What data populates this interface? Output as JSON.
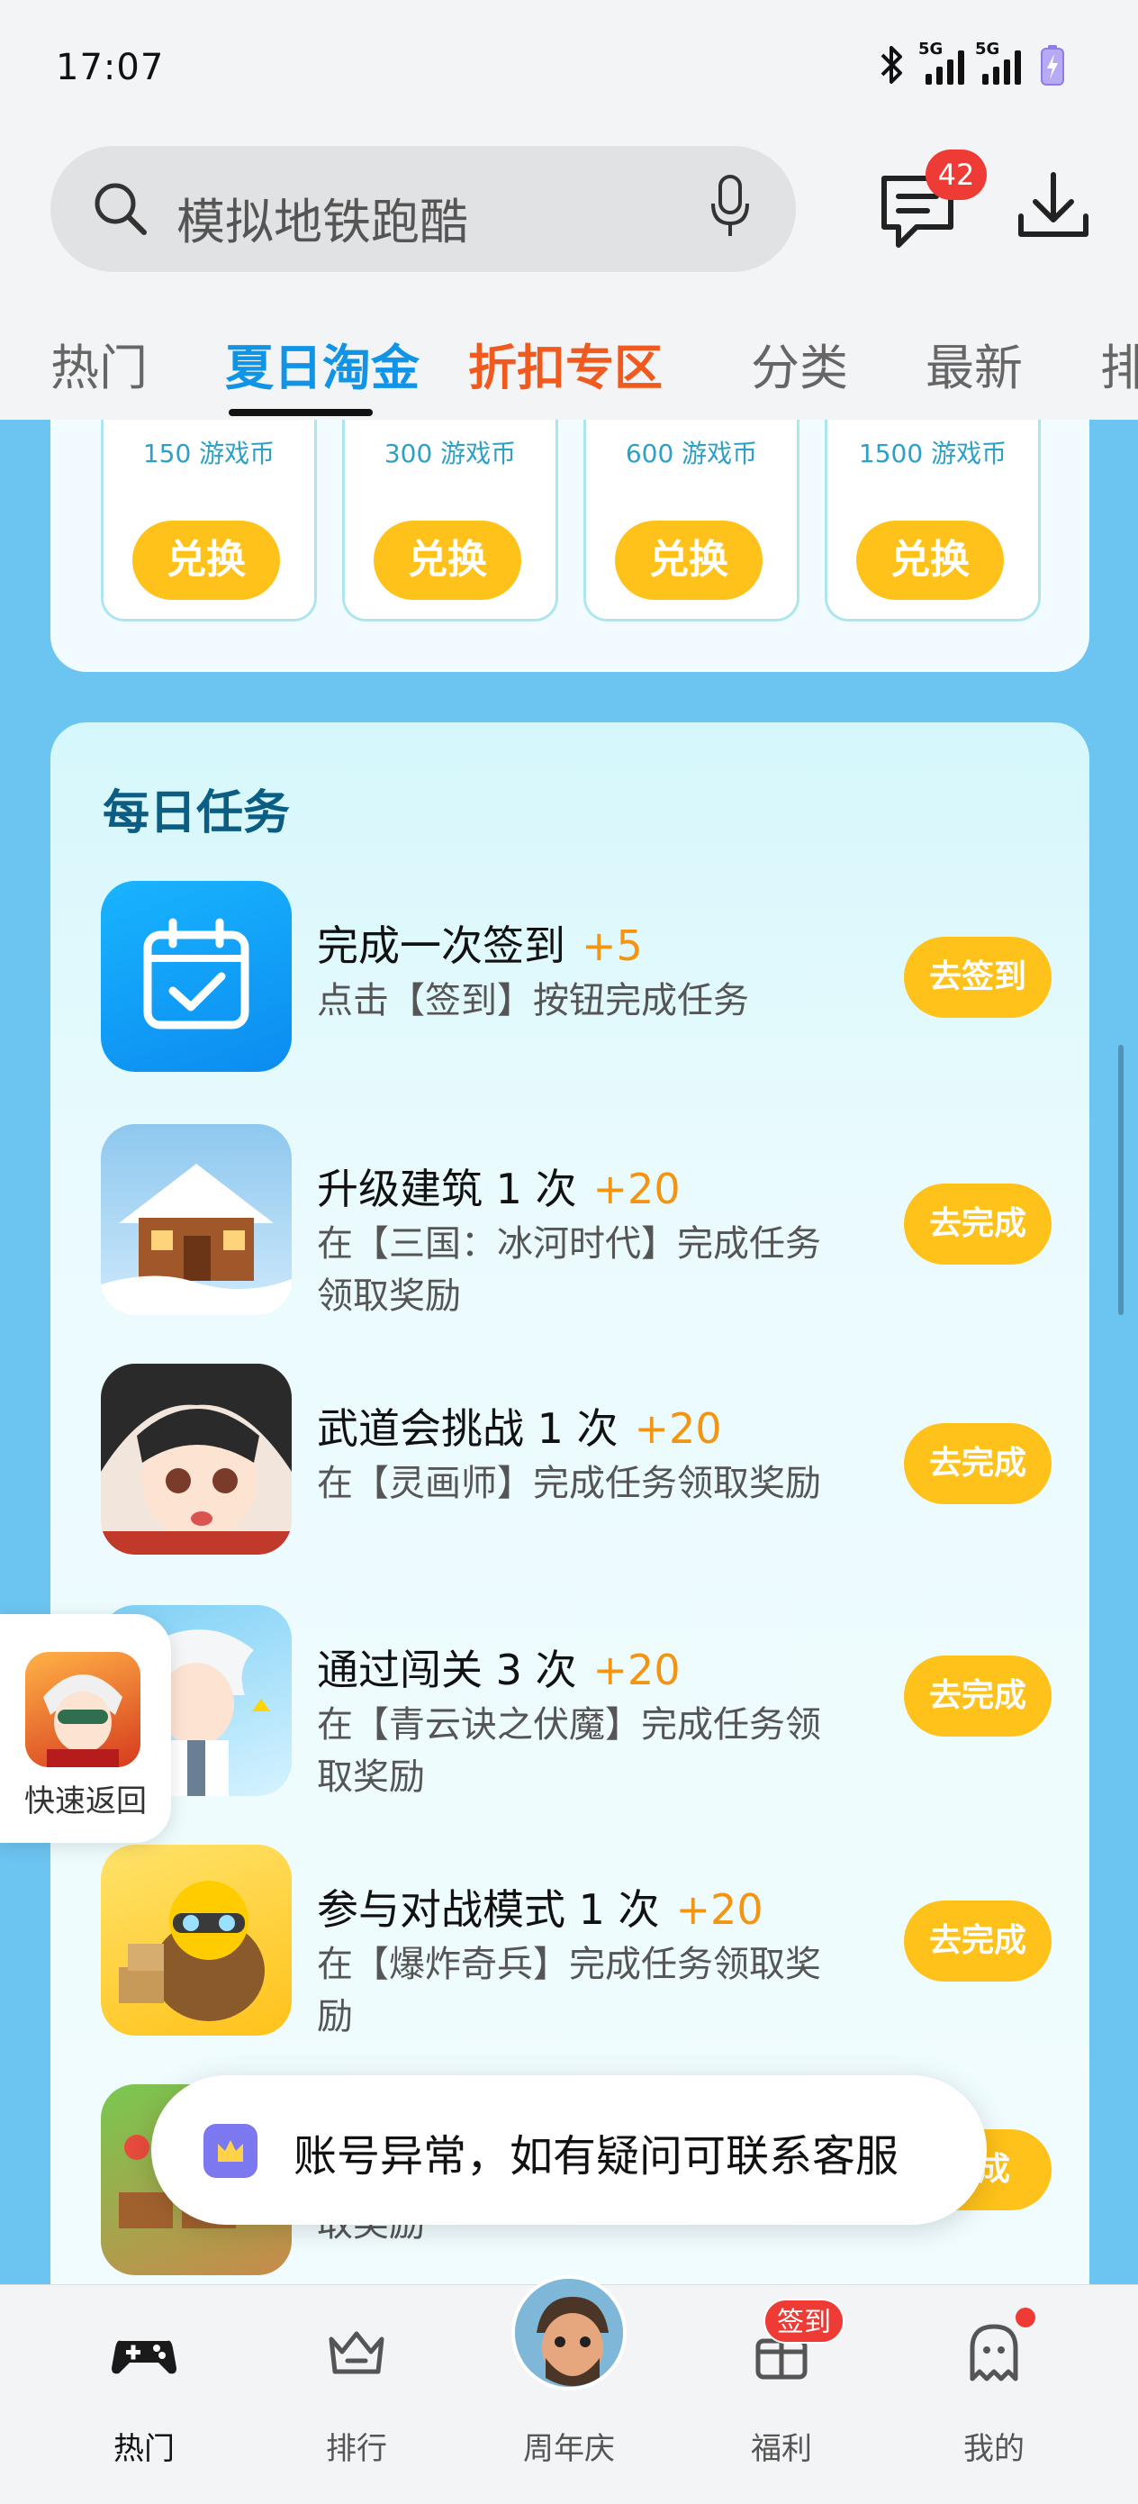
{
  "status_bar": {
    "time": "17:07",
    "network_1": "5G",
    "network_2": "5G"
  },
  "search": {
    "placeholder_text": "模拟地铁跑酷"
  },
  "header": {
    "message_count": "42"
  },
  "tabs": [
    {
      "label": "热门"
    },
    {
      "label": "夏日淘金"
    },
    {
      "label": "折扣专区"
    },
    {
      "label": "分类"
    },
    {
      "label": "最新"
    },
    {
      "label": "排"
    }
  ],
  "coin_exchange": {
    "items": [
      {
        "label": "150 游戏币",
        "button": "兑换"
      },
      {
        "label": "300 游戏币",
        "button": "兑换"
      },
      {
        "label": "600 游戏币",
        "button": "兑换"
      },
      {
        "label": "1500 游戏币",
        "button": "兑换"
      }
    ]
  },
  "daily_tasks": {
    "title": "每日任务",
    "items": [
      {
        "name": "完成一次签到",
        "points": "+5",
        "desc": "点击【签到】按钮完成任务",
        "button": "去签到",
        "icon": "calendar-check-icon"
      },
      {
        "name": "升级建筑 1 次",
        "points": "+20",
        "desc": "在【三国：冰河时代】完成任务领取奖励",
        "button": "去完成",
        "icon": "snow-cabin-game-icon"
      },
      {
        "name": "武道会挑战 1 次",
        "points": "+20",
        "desc": "在【灵画师】完成任务领取奖励",
        "button": "去完成",
        "icon": "anime-girl-game-icon"
      },
      {
        "name": "通过闯关 3 次",
        "points": "+20",
        "desc": "在【青云诀之伏魔】完成任务领取奖励",
        "button": "去完成",
        "icon": "white-hair-hero-game-icon"
      },
      {
        "name": "参与对战模式 1 次",
        "points": "+20",
        "desc": "在【爆炸奇兵】完成任务领取奖励",
        "button": "去完成",
        "icon": "capybara-game-icon"
      },
      {
        "name": "",
        "points": "",
        "desc": "取奖励",
        "button": "完成",
        "icon": "farm-game-icon"
      }
    ]
  },
  "quick_back": {
    "label": "快速返回"
  },
  "toast": {
    "text": "账号异常，如有疑问可联系客服"
  },
  "bottom_nav": {
    "items": [
      {
        "label": "热门"
      },
      {
        "label": "排行"
      },
      {
        "label": "周年庆"
      },
      {
        "label": "福利"
      },
      {
        "label": "我的"
      }
    ],
    "signin_badge": "签到"
  },
  "colors": {
    "accent_blue": "#0f94e6",
    "promo_orange": "#f15a1f",
    "button_yellow": "#ffc21a",
    "points_orange": "#f39412",
    "badge_red": "#ef3b35",
    "page_bg_blue": "#6cc4f0"
  }
}
